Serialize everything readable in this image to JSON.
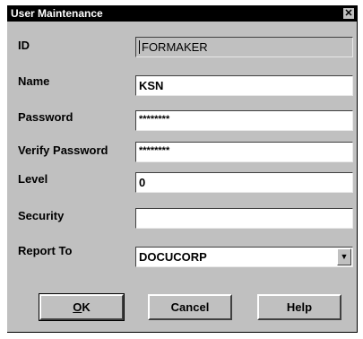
{
  "window": {
    "title": "User Maintenance",
    "close_glyph": "✕"
  },
  "form": {
    "id_label": "ID",
    "id_value": "FORMAKER",
    "name_label": "Name",
    "name_value": "KSN",
    "password_label": "Password",
    "password_value": "********",
    "verify_label": "Verify Password",
    "verify_value": "********",
    "level_label": "Level",
    "level_value": "0",
    "security_label": "Security",
    "security_value": "",
    "reportto_label": "Report To",
    "reportto_value": "DOCUCORP"
  },
  "buttons": {
    "ok": "OK",
    "cancel": "Cancel",
    "help": "Help"
  }
}
